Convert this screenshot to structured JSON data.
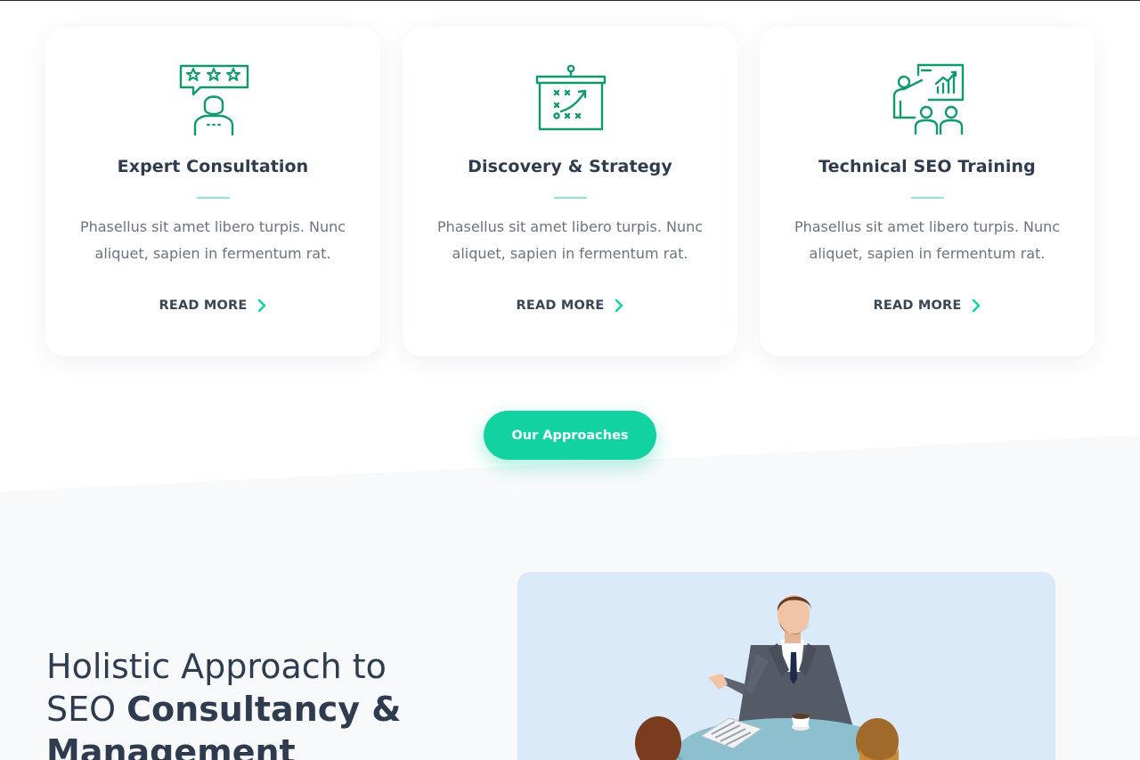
{
  "services": [
    {
      "icon": "rating-review-icon",
      "title": "Expert Consultation",
      "text_line1": "Phasellus sit amet libero turpis. Nunc",
      "text_line2": "aliquet, sapien in fermentum rat.",
      "link_label": "READ MORE"
    },
    {
      "icon": "strategy-board-icon",
      "title": "Discovery & Strategy",
      "text_line1": "Phasellus sit amet libero turpis. Nunc",
      "text_line2": "aliquet, sapien in fermentum rat.",
      "link_label": "READ MORE"
    },
    {
      "icon": "presentation-training-icon",
      "title": "Technical SEO Training",
      "text_line1": "Phasellus sit amet libero turpis. Nunc",
      "text_line2": "aliquet, sapien in fermentum rat.",
      "link_label": "READ MORE"
    }
  ],
  "cta": {
    "label": "Our Approaches"
  },
  "about": {
    "heading_light": "Holistic Approach to SEO",
    "heading_bold": "Consultancy & Management"
  },
  "colors": {
    "accent": "#12d2a2",
    "icon_green": "#129a6c",
    "heading": "#2f3c50",
    "body_text": "#6b7280",
    "illustration_bg": "#dbeaf9"
  }
}
